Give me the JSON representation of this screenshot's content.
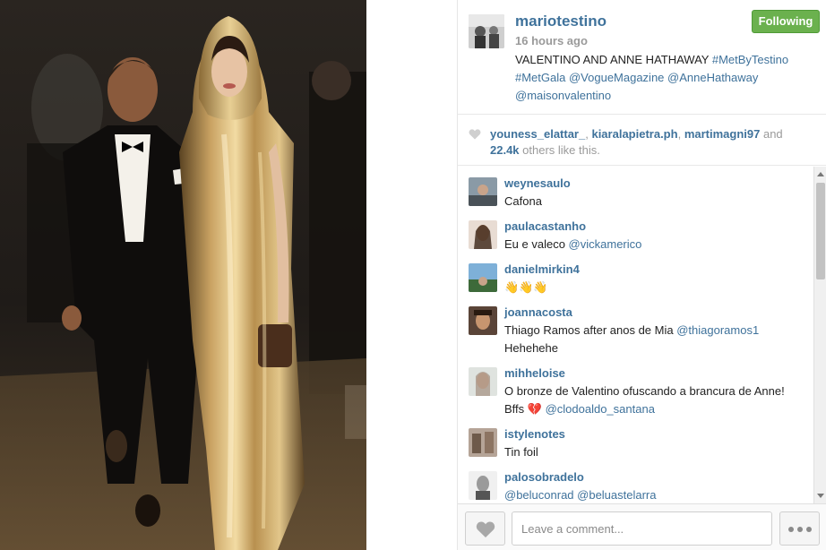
{
  "post": {
    "owner": "mariotestino",
    "timestamp": "16 hours ago",
    "follow_label": "Following",
    "caption": {
      "text": "VALENTINO AND ANNE HATHAWAY ",
      "tags_line1": "#MetByTestino",
      "tags_line2": "#MetGala @VogueMagazine @AnneHathaway",
      "tags_line3": "@maisonvalentino"
    }
  },
  "likes": {
    "user1": "youness_elattar_",
    "sep1": ", ",
    "user2": "kiaralapietra.ph",
    "sep2": ", ",
    "user3": "martimagni97",
    "and": " and",
    "count": "22.4k",
    "suffix": " others like this."
  },
  "comments": [
    {
      "user": "weynesaulo",
      "text": "Cafona",
      "mention": "",
      "line2": ""
    },
    {
      "user": "paulacastanho",
      "text": "Eu e valeco ",
      "mention": "@vickamerico",
      "line2": ""
    },
    {
      "user": "danielmirkin4",
      "text": "👋👋👋",
      "mention": "",
      "line2": ""
    },
    {
      "user": "joannacosta",
      "text": "Thiago Ramos after anos de Mia ",
      "mention": "@thiagoramos1",
      "line2": "Hehehehe"
    },
    {
      "user": "mihheloise",
      "text": "O bronze de Valentino ofuscando a brancura de Anne!",
      "mention": "",
      "line2": "Bffs 💔 ",
      "line2_mention": "@clodoaldo_santana"
    },
    {
      "user": "istylenotes",
      "text": "Tin foil",
      "mention": "",
      "line2": ""
    },
    {
      "user": "palosobradelo",
      "text": "",
      "mention": "@beluconrad @beluastelarra",
      "line2": ""
    }
  ],
  "footer": {
    "comment_placeholder": "Leave a comment..."
  },
  "icons": {
    "like": "heart-icon",
    "more": "more-dots-icon"
  },
  "colors": {
    "link": "#3f729b",
    "following_bg": "#6bb14e",
    "muted": "#9a9a9a"
  }
}
